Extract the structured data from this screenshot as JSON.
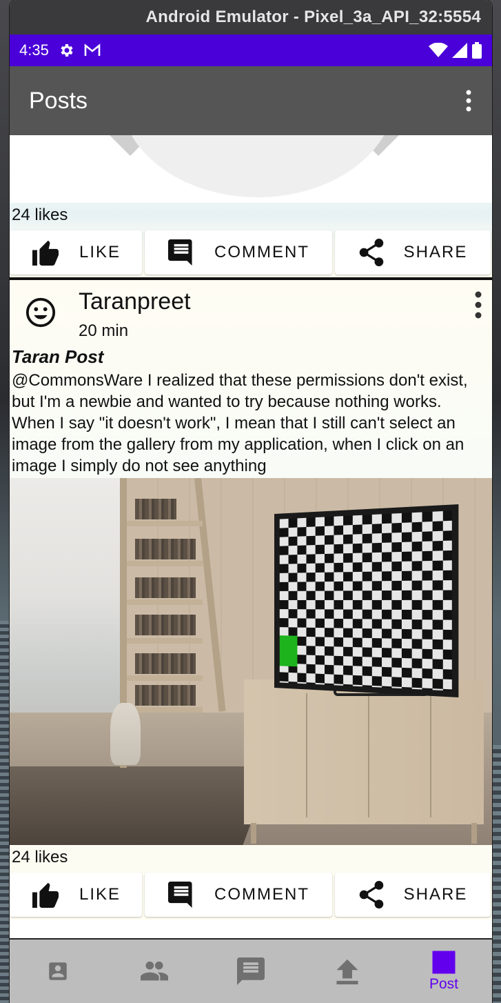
{
  "window": {
    "title": "Android Emulator - Pixel_3a_API_32:5554"
  },
  "status_bar": {
    "time": "4:35"
  },
  "app_bar": {
    "title": "Posts"
  },
  "posts": [
    {
      "likes": "24 likes",
      "actions": {
        "like": "LIKE",
        "comment": "COMMENT",
        "share": "SHARE"
      }
    },
    {
      "author": "Taranpreet",
      "time": "20 min",
      "title": "Taran Post",
      "body": "@CommonsWare I realized that these permissions don't exist, but I'm a newbie and wanted to try because nothing works. When I say \"it doesn't work\", I mean that I still can't select an image from the gallery from my application, when I click on an image I simply do not see anything",
      "likes": "24 likes",
      "actions": {
        "like": "LIKE",
        "comment": "COMMENT",
        "share": "SHARE"
      }
    }
  ],
  "bottom_nav": {
    "items": [
      {
        "icon": "account-box-icon"
      },
      {
        "icon": "people-icon"
      },
      {
        "icon": "message-icon"
      },
      {
        "icon": "upload-icon"
      },
      {
        "icon": "post-square-icon",
        "label": "Post",
        "active": true
      }
    ]
  },
  "colors": {
    "status_bar": "#4a00d8",
    "app_bar": "#555555",
    "accent": "#6200ee",
    "bottom_nav": "#bdbdbd"
  }
}
